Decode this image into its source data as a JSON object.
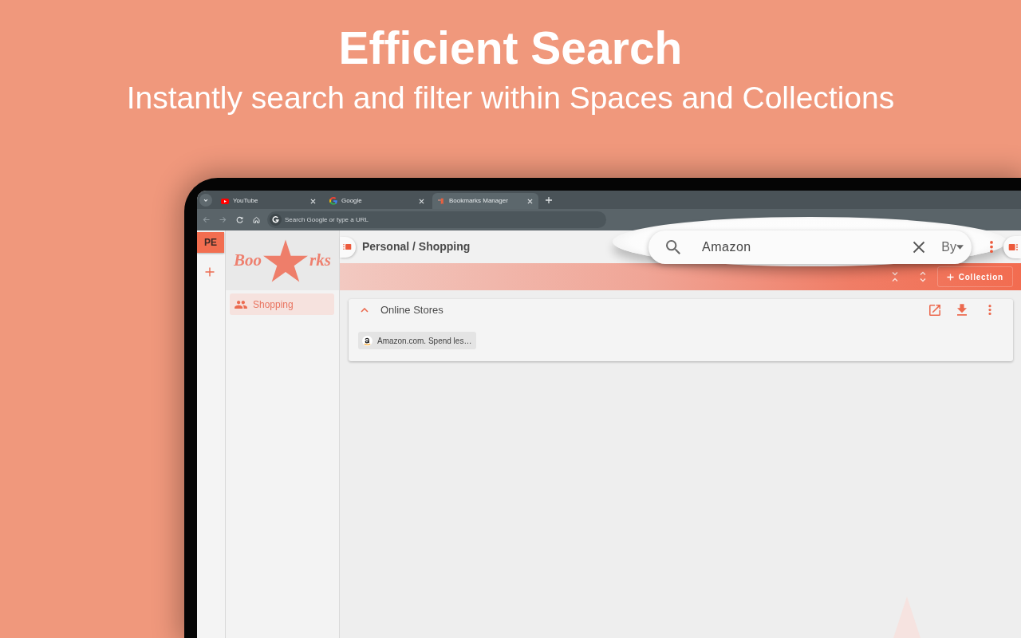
{
  "headline": {
    "title": "Efficient Search",
    "subtitle": "Instantly search and filter within Spaces and Collections"
  },
  "browser": {
    "tabs": [
      {
        "title": "YouTube",
        "selected": false
      },
      {
        "title": "Google",
        "selected": false
      },
      {
        "title": "Bookmarks Manager",
        "selected": true
      }
    ],
    "address_bar": {
      "placeholder": "Search Google or type a URL"
    }
  },
  "spaces": [
    {
      "label": "PE",
      "selected": true
    }
  ],
  "logo": {
    "left": "Boo",
    "right": "rks"
  },
  "sidebar": {
    "items": [
      {
        "label": "Shopping",
        "selected": true
      }
    ]
  },
  "breadcrumb": "Personal / Shopping",
  "search": {
    "value": "Amazon",
    "filter_label": "By"
  },
  "toolbar": {
    "add_label": "Collection"
  },
  "collections": [
    {
      "title": "Online Stores",
      "expanded": true,
      "bookmarks": [
        {
          "title": "Amazon.com. Spend les…"
        }
      ]
    }
  ]
}
